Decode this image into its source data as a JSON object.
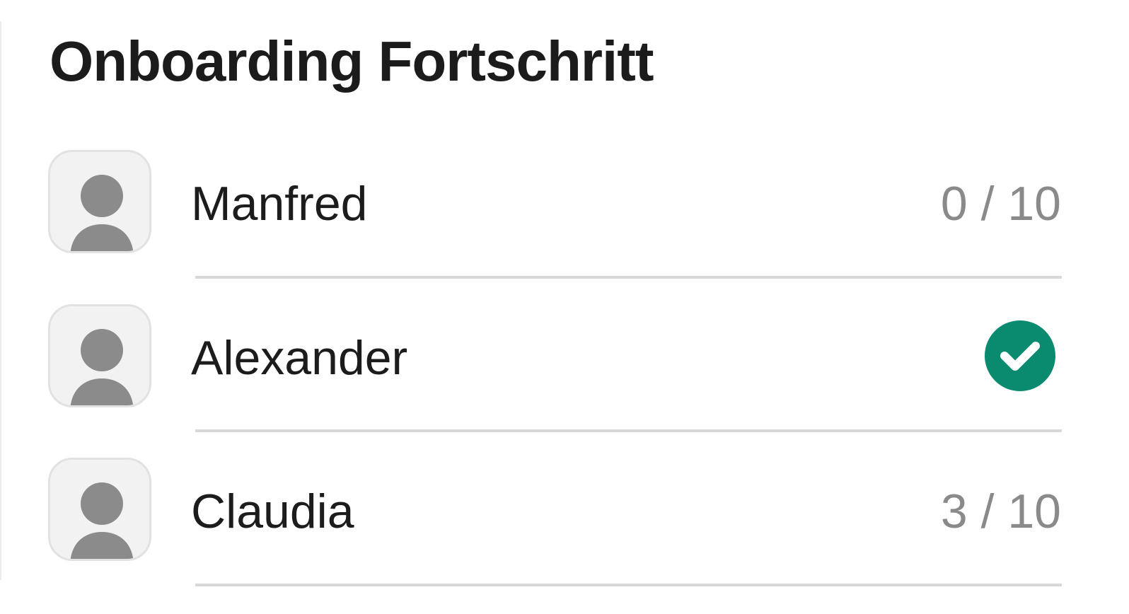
{
  "page": {
    "title": "Onboarding Fortschritt"
  },
  "members": [
    {
      "name": "Manfred",
      "progress_label": "0 / 10",
      "completed": false
    },
    {
      "name": "Alexander",
      "progress_label": "",
      "completed": true
    },
    {
      "name": "Claudia",
      "progress_label": "3 / 10",
      "completed": false
    }
  ],
  "icons": {
    "avatar": "person-placeholder-icon",
    "completed": "check-circle-icon"
  },
  "colors": {
    "accent": "#0a8a6e",
    "avatar_bg": "#f2f2f2",
    "avatar_figure": "#8b8b8b",
    "muted_text": "#8a8a8a",
    "divider": "#d8d8d8"
  }
}
